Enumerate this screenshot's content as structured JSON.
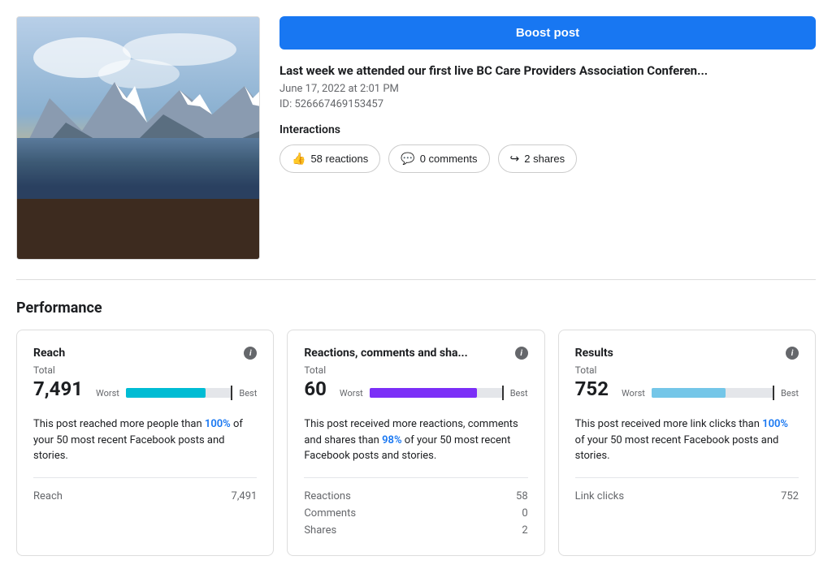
{
  "boost_button": {
    "label": "Boost post"
  },
  "post": {
    "title": "Last week we attended our first live BC Care Providers Association Conferen...",
    "date": "June 17, 2022 at 2:01 PM",
    "id_label": "ID: 526667469153457",
    "interactions_label": "Interactions"
  },
  "interaction_buttons": [
    {
      "icon": "👍",
      "label": "58 reactions"
    },
    {
      "icon": "💬",
      "label": "0 comments"
    },
    {
      "icon": "↪",
      "label": "2 shares"
    }
  ],
  "performance": {
    "section_title": "Performance",
    "cards": [
      {
        "id": "reach",
        "title": "Reach",
        "total_label": "Total",
        "value": "7,491",
        "progress_worst": "Worst",
        "progress_best": "Best",
        "progress_color": "reach",
        "description": "This post reached more people than",
        "highlight": "100%",
        "description_suffix": "of your 50 most recent Facebook posts and stories.",
        "stats": [
          {
            "name": "Reach",
            "value": "7,491"
          }
        ]
      },
      {
        "id": "reactions",
        "title": "Reactions, comments and sha...",
        "total_label": "Total",
        "value": "60",
        "progress_worst": "Worst",
        "progress_best": "Best",
        "progress_color": "reactions",
        "description": "This post received more reactions, comments and shares than",
        "highlight": "98%",
        "description_suffix": "of your 50 most recent Facebook posts and stories.",
        "stats": [
          {
            "name": "Reactions",
            "value": "58"
          },
          {
            "name": "Comments",
            "value": "0"
          },
          {
            "name": "Shares",
            "value": "2"
          }
        ]
      },
      {
        "id": "results",
        "title": "Results",
        "total_label": "Total",
        "value": "752",
        "progress_worst": "Worst",
        "progress_best": "Best",
        "progress_color": "results",
        "description": "This post received more link clicks than",
        "highlight": "100%",
        "description_suffix": "of your 50 most recent Facebook posts and stories.",
        "stats": [
          {
            "name": "Link clicks",
            "value": "752"
          }
        ]
      }
    ]
  },
  "info_icon_label": "i"
}
